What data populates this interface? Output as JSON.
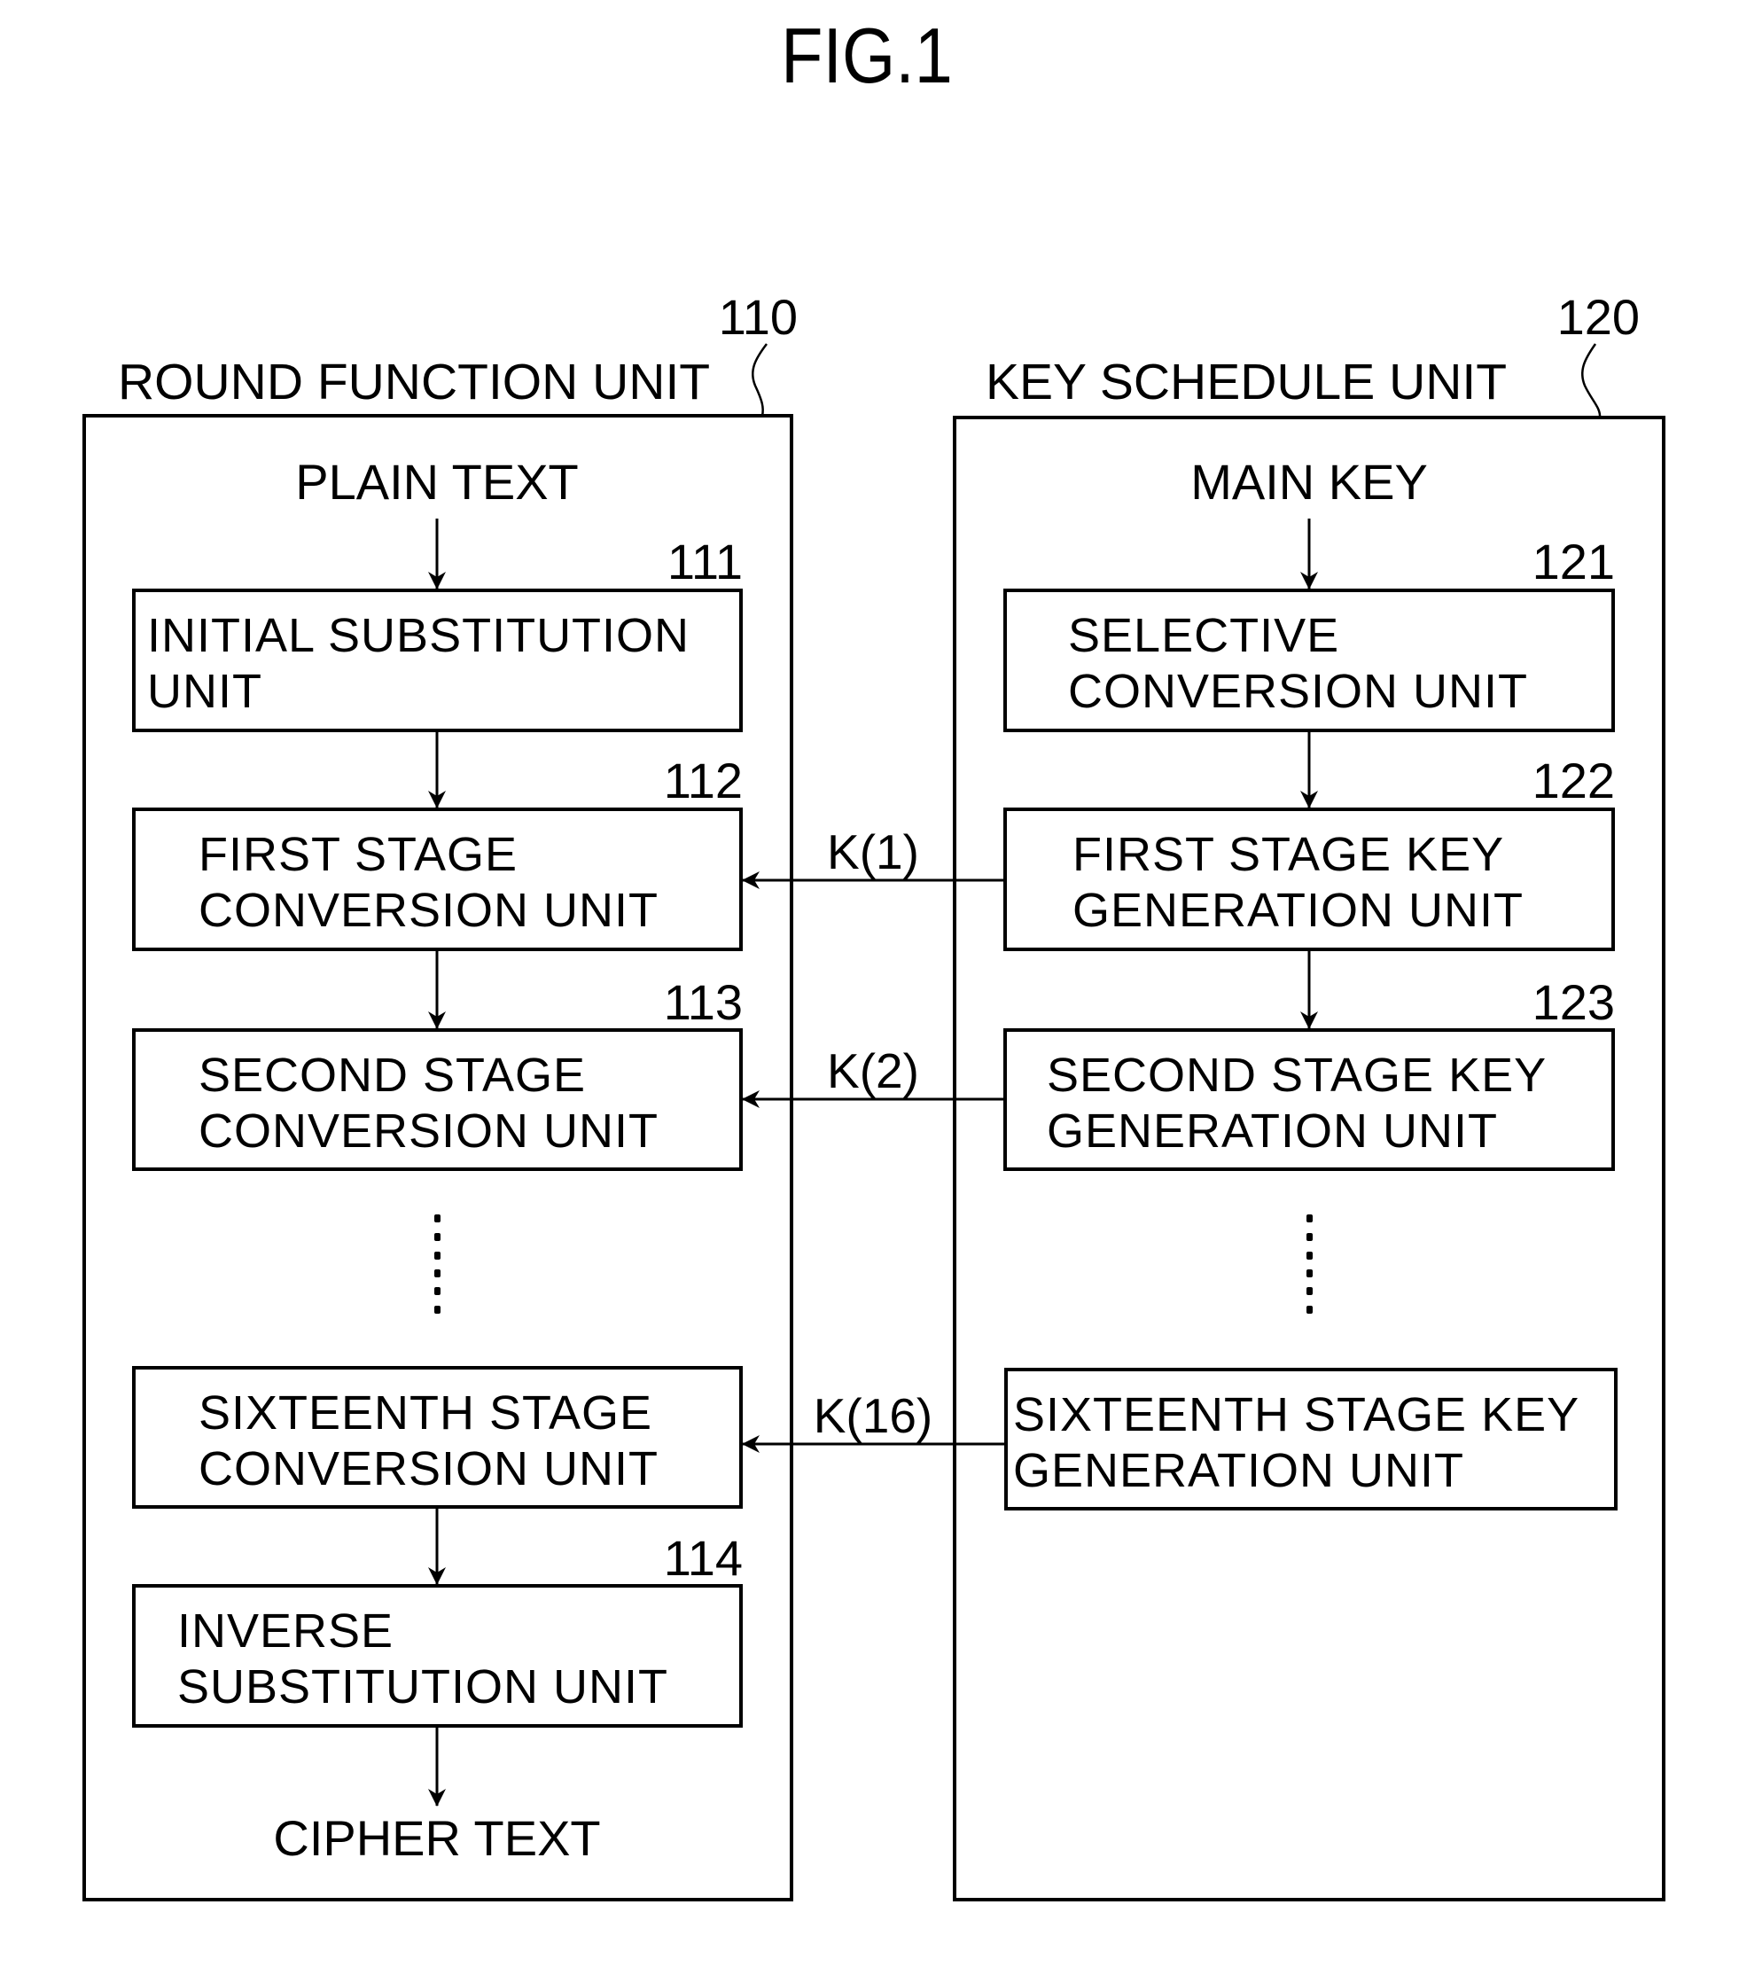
{
  "figure": {
    "title": "FIG.1"
  },
  "round_function_unit": {
    "label": "ROUND FUNCTION UNIT",
    "ref": "110",
    "input_label": "PLAIN TEXT",
    "output_label": "CIPHER TEXT",
    "blocks": [
      {
        "ref": "111",
        "lines": [
          "INITIAL SUBSTITUTION",
          "UNIT"
        ]
      },
      {
        "ref": "112",
        "lines": [
          "FIRST STAGE",
          "CONVERSION UNIT"
        ]
      },
      {
        "ref": "113",
        "lines": [
          "SECOND STAGE",
          "CONVERSION UNIT"
        ]
      },
      {
        "ref": "",
        "lines": [
          "SIXTEENTH STAGE",
          "CONVERSION UNIT"
        ]
      },
      {
        "ref": "114",
        "lines": [
          "INVERSE",
          "SUBSTITUTION UNIT"
        ]
      }
    ],
    "ellipsis": "......"
  },
  "key_schedule_unit": {
    "label": "KEY SCHEDULE UNIT",
    "ref": "120",
    "input_label": "MAIN KEY",
    "blocks": [
      {
        "ref": "121",
        "lines": [
          "SELECTIVE",
          "CONVERSION UNIT"
        ]
      },
      {
        "ref": "122",
        "lines": [
          "FIRST STAGE KEY",
          "GENERATION UNIT"
        ]
      },
      {
        "ref": "123",
        "lines": [
          "SECOND STAGE KEY",
          "GENERATION UNIT"
        ]
      },
      {
        "ref": "",
        "lines": [
          "SIXTEENTH STAGE KEY",
          "GENERATION UNIT"
        ]
      }
    ],
    "ellipsis": "......"
  },
  "subkeys": [
    {
      "label": "K(1)",
      "from": "FIRST STAGE KEY GENERATION UNIT",
      "to": "FIRST STAGE CONVERSION UNIT"
    },
    {
      "label": "K(2)",
      "from": "SECOND STAGE KEY GENERATION UNIT",
      "to": "SECOND STAGE CONVERSION UNIT"
    },
    {
      "label": "K(16)",
      "from": "SIXTEENTH STAGE KEY GENERATION UNIT",
      "to": "SIXTEENTH STAGE CONVERSION UNIT"
    }
  ]
}
